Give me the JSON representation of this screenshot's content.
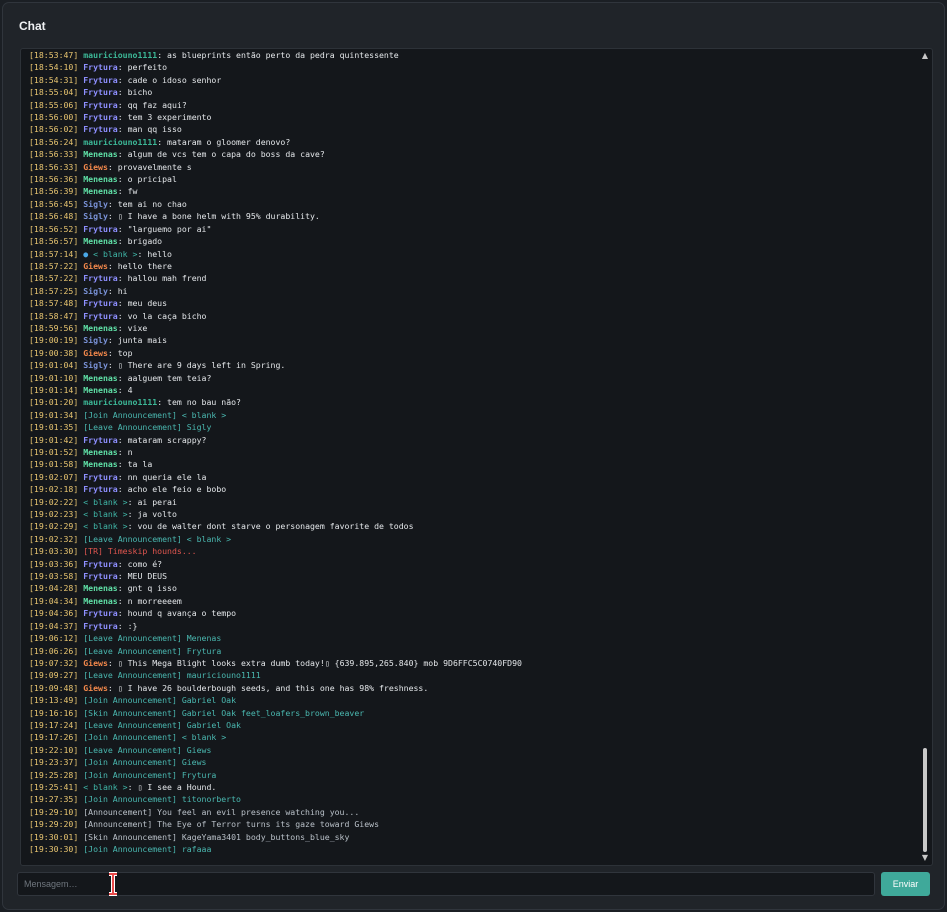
{
  "title": "Chat",
  "input": {
    "placeholder": "Mensagem…",
    "value": ""
  },
  "send_label": "Enviar",
  "colors": {
    "mauriciouno1111": "#3cb897",
    "Frytura": "#8e8fff",
    "Menenas": "#5fe0a6",
    "Giews": "#f2884b",
    "Sigly": "#7a93d8",
    "< blank >": "#3fb6a7",
    "timestamp": "#e8c570",
    "announcement": "#4ab8b0",
    "announcement_gray": "#b9c0c8",
    "tr": "#e0564f",
    "send_button": "#3fa99a"
  },
  "messages": [
    {
      "ts": "[18:53:47]",
      "user": "mauriciouno1111",
      "text": "as blueprints então perto da pedra quintessente"
    },
    {
      "ts": "[18:54:10]",
      "user": "Frytura",
      "text": "perfeito"
    },
    {
      "ts": "[18:54:31]",
      "user": "Frytura",
      "text": "cade o idoso senhor"
    },
    {
      "ts": "[18:55:04]",
      "user": "Frytura",
      "text": "bicho"
    },
    {
      "ts": "[18:55:06]",
      "user": "Frytura",
      "text": "qq faz aqui?"
    },
    {
      "ts": "[18:56:00]",
      "user": "Frytura",
      "text": "tem 3 experimento"
    },
    {
      "ts": "[18:56:02]",
      "user": "Frytura",
      "text": "man qq isso"
    },
    {
      "ts": "[18:56:24]",
      "user": "mauriciouno1111",
      "text": "mataram o gloomer denovo?"
    },
    {
      "ts": "[18:56:33]",
      "user": "Menenas",
      "text": "algum de vcs tem o capa do boss da cave?"
    },
    {
      "ts": "[18:56:33]",
      "user": "Giews",
      "text": "provavelmente s"
    },
    {
      "ts": "[18:56:36]",
      "user": "Menenas",
      "text": "o pricipal"
    },
    {
      "ts": "[18:56:39]",
      "user": "Menenas",
      "text": "fw"
    },
    {
      "ts": "[18:56:45]",
      "user": "Sigly",
      "text": "tem ai no chao"
    },
    {
      "ts": "[18:56:48]",
      "user": "Sigly",
      "text": "▯ I have a bone helm with 95% durability."
    },
    {
      "ts": "[18:56:52]",
      "user": "Frytura",
      "text": "\"larguemo por ai\""
    },
    {
      "ts": "[18:56:57]",
      "user": "Menenas",
      "text": "brigado"
    },
    {
      "ts": "[18:57:14]",
      "user": "< blank >",
      "prefix": "●",
      "text": "hello"
    },
    {
      "ts": "[18:57:22]",
      "user": "Giews",
      "text": "hello there"
    },
    {
      "ts": "[18:57:22]",
      "user": "Frytura",
      "text": "hallou mah frend"
    },
    {
      "ts": "[18:57:25]",
      "user": "Sigly",
      "text": "hi"
    },
    {
      "ts": "[18:57:48]",
      "user": "Frytura",
      "text": "meu deus"
    },
    {
      "ts": "[18:58:47]",
      "user": "Frytura",
      "text": "vo la caça bicho"
    },
    {
      "ts": "[18:59:56]",
      "user": "Menenas",
      "text": "vixe"
    },
    {
      "ts": "[19:00:19]",
      "user": "Sigly",
      "text": "junta  mais"
    },
    {
      "ts": "[19:00:38]",
      "user": "Giews",
      "text": "top"
    },
    {
      "ts": "[19:01:04]",
      "user": "Sigly",
      "text": "▯ There are 9 days left in Spring."
    },
    {
      "ts": "[19:01:10]",
      "user": "Menenas",
      "text": "aalguem tem teia?"
    },
    {
      "ts": "[19:01:14]",
      "user": "Menenas",
      "text": "4"
    },
    {
      "ts": "[19:01:20]",
      "user": "mauriciouno1111",
      "text": "tem no bau não?"
    },
    {
      "ts": "[19:01:34]",
      "sys": "[Join Announcement] < blank >"
    },
    {
      "ts": "[19:01:35]",
      "sys": "[Leave Announcement] Sigly"
    },
    {
      "ts": "[19:01:42]",
      "user": "Frytura",
      "text": "mataram scrappy?"
    },
    {
      "ts": "[19:01:52]",
      "user": "Menenas",
      "text": "n"
    },
    {
      "ts": "[19:01:58]",
      "user": "Menenas",
      "text": "ta la"
    },
    {
      "ts": "[19:02:07]",
      "user": "Frytura",
      "text": "nn queria ele la"
    },
    {
      "ts": "[19:02:18]",
      "user": "Frytura",
      "text": "acho ele feio e bobo"
    },
    {
      "ts": "[19:02:22]",
      "user": "< blank >",
      "text": "ai perai"
    },
    {
      "ts": "[19:02:23]",
      "user": "< blank >",
      "text": "ja volto"
    },
    {
      "ts": "[19:02:29]",
      "user": "< blank >",
      "text": "vou de walter dont starve o personagem favorite de todos"
    },
    {
      "ts": "[19:02:32]",
      "sys": "[Leave Announcement] < blank >"
    },
    {
      "ts": "[19:03:30]",
      "red": "[TR] Timeskip hounds..."
    },
    {
      "ts": "[19:03:36]",
      "user": "Frytura",
      "text": "como é?"
    },
    {
      "ts": "[19:03:58]",
      "user": "Frytura",
      "text": "MEU DEUS"
    },
    {
      "ts": "[19:04:28]",
      "user": "Menenas",
      "text": "gnt q isso"
    },
    {
      "ts": "[19:04:34]",
      "user": "Menenas",
      "text": "n morreeeem"
    },
    {
      "ts": "[19:04:36]",
      "user": "Frytura",
      "text": "hound q avança o tempo"
    },
    {
      "ts": "[19:04:37]",
      "user": "Frytura",
      "text": ":}"
    },
    {
      "ts": "[19:06:12]",
      "sys": "[Leave Announcement] Menenas"
    },
    {
      "ts": "[19:06:26]",
      "sys": "[Leave Announcement] Frytura"
    },
    {
      "ts": "[19:07:32]",
      "user": "Giews",
      "text": "▯ This Mega Blight looks extra dumb today!▯ {639.895,265.840} mob 9D6FFC5C0740FD90"
    },
    {
      "ts": "[19:09:27]",
      "sys": "[Leave Announcement] mauriciouno1111"
    },
    {
      "ts": "[19:09:48]",
      "user": "Giews",
      "text": "▯ I have 26 boulderbough seeds, and this one has 98% freshness."
    },
    {
      "ts": "[19:13:49]",
      "sys": "[Join Announcement] Gabriel Oak"
    },
    {
      "ts": "[19:16:16]",
      "sys": "[Skin Announcement] Gabriel Oak feet_loafers_brown_beaver"
    },
    {
      "ts": "[19:17:24]",
      "sys": "[Leave Announcement] Gabriel Oak"
    },
    {
      "ts": "[19:17:26]",
      "sys": "[Join Announcement] < blank >"
    },
    {
      "ts": "[19:22:10]",
      "sys": "[Leave Announcement] Giews"
    },
    {
      "ts": "[19:23:37]",
      "sys": "[Join Announcement] Giews"
    },
    {
      "ts": "[19:25:28]",
      "sys": "[Join Announcement] Frytura"
    },
    {
      "ts": "[19:25:41]",
      "user": "< blank >",
      "text": "▯ I see a Hound."
    },
    {
      "ts": "[19:27:35]",
      "sys": "[Join Announcement] titonorberto"
    },
    {
      "ts": "[19:29:10]",
      "gray": "[Announcement] You feel an evil presence watching you..."
    },
    {
      "ts": "[19:29:20]",
      "gray": "[Announcement] The Eye of Terror turns its gaze toward Giews"
    },
    {
      "ts": "[19:30:01]",
      "gray": "[Skin Announcement] KageYama3401 body_buttons_blue_sky"
    },
    {
      "ts": "[19:30:30]",
      "sys": "[Join Announcement] rafaaa"
    }
  ]
}
